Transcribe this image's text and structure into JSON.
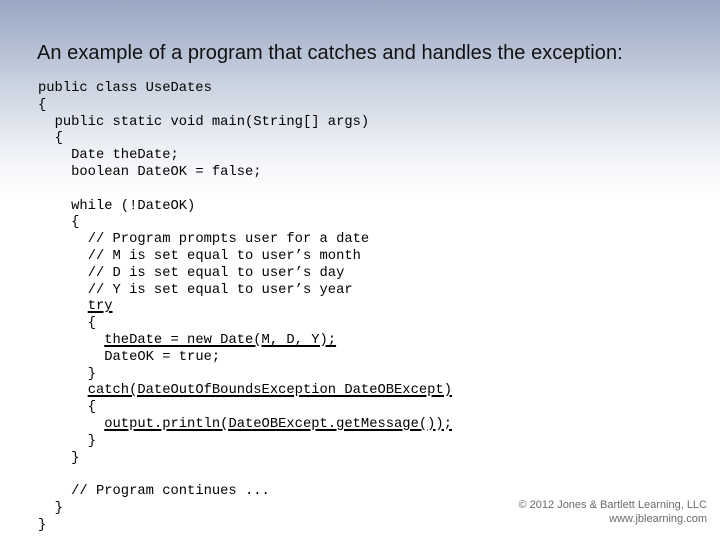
{
  "slide": {
    "title": "An example of a program that catches and handles the exception:"
  },
  "code": {
    "language": "java",
    "lines": [
      {
        "indent": 0,
        "text": "public class UseDates",
        "underline": false
      },
      {
        "indent": 0,
        "text": "{",
        "underline": false
      },
      {
        "indent": 1,
        "text": "public static void main(String[] args)",
        "underline": false
      },
      {
        "indent": 1,
        "text": "{",
        "underline": false
      },
      {
        "indent": 2,
        "text": "Date theDate;",
        "underline": false
      },
      {
        "indent": 2,
        "text": "boolean DateOK = false;",
        "underline": false
      },
      {
        "indent": 0,
        "text": "",
        "underline": false
      },
      {
        "indent": 2,
        "text": "while (!DateOK)",
        "underline": false
      },
      {
        "indent": 2,
        "text": "{",
        "underline": false
      },
      {
        "indent": 3,
        "text": "// Program prompts user for a date",
        "underline": false
      },
      {
        "indent": 3,
        "text": "// M is set equal to user’s month",
        "underline": false
      },
      {
        "indent": 3,
        "text": "// D is set equal to user’s day",
        "underline": false
      },
      {
        "indent": 3,
        "text": "// Y is set equal to user’s year",
        "underline": false
      },
      {
        "indent": 3,
        "text": "try",
        "underline": true
      },
      {
        "indent": 3,
        "text": "{",
        "underline": false
      },
      {
        "indent": 4,
        "text": "theDate = new Date(M, D, Y);",
        "underline": true
      },
      {
        "indent": 4,
        "text": "DateOK = true;",
        "underline": false
      },
      {
        "indent": 3,
        "text": "}",
        "underline": false
      },
      {
        "indent": 3,
        "text": "catch(DateOutOfBoundsException DateOBExcept)",
        "underline": true
      },
      {
        "indent": 3,
        "text": "{",
        "underline": false
      },
      {
        "indent": 4,
        "text": "output.println(DateOBExcept.getMessage());",
        "underline": true
      },
      {
        "indent": 3,
        "text": "}",
        "underline": false
      },
      {
        "indent": 2,
        "text": "}",
        "underline": false
      },
      {
        "indent": 0,
        "text": "",
        "underline": false
      },
      {
        "indent": 2,
        "text": "// Program continues ...",
        "underline": false
      },
      {
        "indent": 1,
        "text": "}",
        "underline": false
      },
      {
        "indent": 0,
        "text": "}",
        "underline": false
      }
    ]
  },
  "footer": {
    "copyright": "© 2012 Jones & Bartlett Learning, LLC",
    "website": "www.jblearning.com"
  },
  "colors": {
    "header_gradient_top": "#98a6c2",
    "background": "#ffffff",
    "title_text": "#111111",
    "code_text": "#000000",
    "footer_text": "#6b6b6b"
  }
}
